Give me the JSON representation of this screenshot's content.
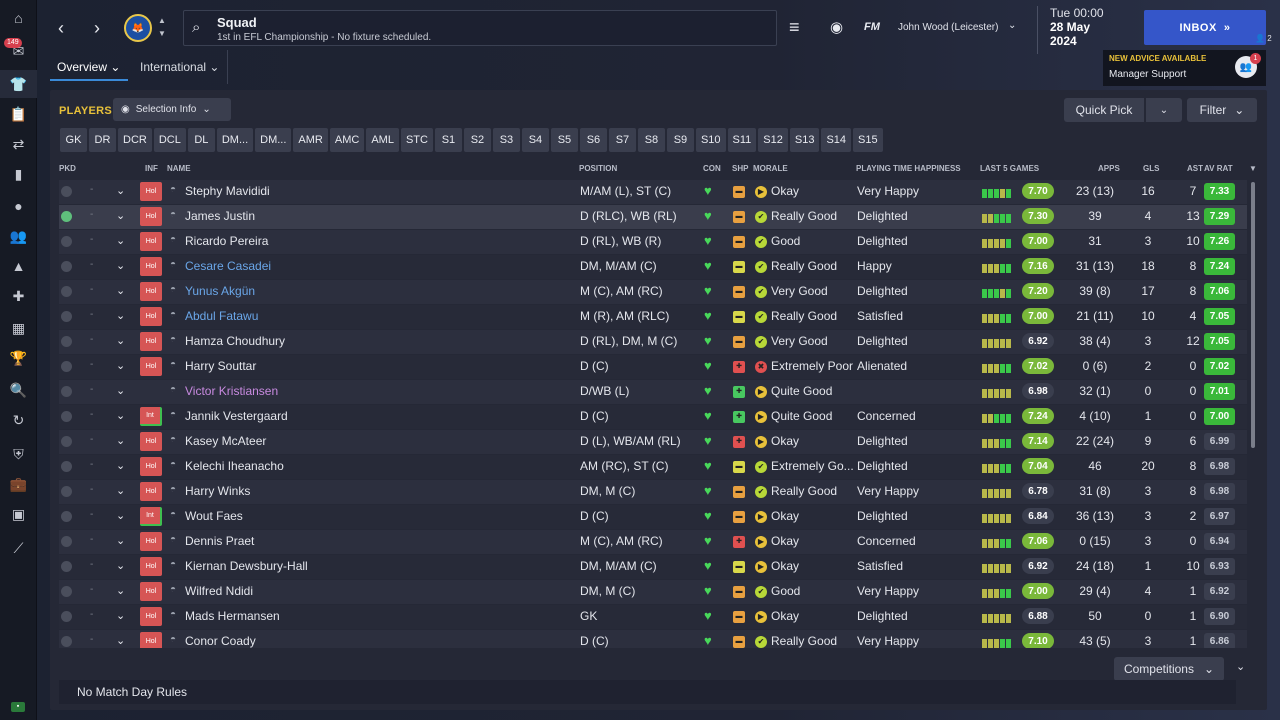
{
  "sidebar": {
    "badge": "149"
  },
  "header": {
    "title": "Squad",
    "subtitle": "1st in EFL Championship - No fixture scheduled.",
    "brand": "FM",
    "manager": "John Wood (Leicester)",
    "date_line1": "Tue 00:00",
    "date_line2": "28 May",
    "date_line3": "2024",
    "inbox_label": "INBOX",
    "inbox_count": "2",
    "advice_title": "NEW ADVICE AVAILABLE",
    "advice_sub": "Manager Support",
    "advice_badge": "1",
    "tabs": [
      "Overview",
      "International"
    ]
  },
  "toolbar": {
    "players_label": "PLAYERS",
    "selection_info": "Selection Info",
    "quick_pick": "Quick Pick",
    "filter": "Filter",
    "position_tabs": [
      "GK",
      "DR",
      "DCR",
      "DCL",
      "DL",
      "DM...",
      "DM...",
      "AMR",
      "AMC",
      "AML",
      "STC",
      "S1",
      "S2",
      "S3",
      "S4",
      "S5",
      "S6",
      "S7",
      "S8",
      "S9",
      "S10",
      "S11",
      "S12",
      "S13",
      "S14",
      "S15"
    ]
  },
  "columns": {
    "pkd": "PKD",
    "inf": "INF",
    "name": "NAME",
    "position": "POSITION",
    "con": "CON",
    "shp": "SHP",
    "morale": "MORALE",
    "pth": "PLAYING TIME HAPPINESS",
    "last5": "LAST 5 GAMES",
    "apps": "APPS",
    "gls": "GLS",
    "ast": "AST",
    "avrat": "AV RAT"
  },
  "colors": {
    "shp_good": "#d8d84a",
    "shp_ok": "#e8a040",
    "shp_bad": "#e05050",
    "shp_great": "#48c860",
    "morale_good": "#b8d838",
    "morale_ok": "#e8c13a",
    "morale_bad": "#e05050",
    "rating_high": "#3ab83a",
    "rating_mid": "#7ab83a",
    "rating_low": "#3a3e4e"
  },
  "players": [
    {
      "pkd": false,
      "inf": "Hol",
      "name": "Stephy Mavididi",
      "style": "",
      "position": "M/AM (L), ST (C)",
      "shp": "ok",
      "morale_icon": "ok",
      "morale": "Okay",
      "pth": "Very Happy",
      "last5": "gggyg",
      "avg5": "7.70",
      "apps": "23 (13)",
      "gls": "16",
      "ast": "7",
      "avrat": "7.33",
      "avrat_tier": "high"
    },
    {
      "pkd": true,
      "inf": "Hol",
      "name": "James Justin",
      "style": "",
      "position": "D (RLC), WB (RL)",
      "shp": "ok",
      "morale_icon": "good",
      "morale": "Really Good",
      "pth": "Delighted",
      "last5": "yyggg",
      "avg5": "7.30",
      "apps": "39",
      "gls": "4",
      "ast": "13",
      "avrat": "7.29",
      "avrat_tier": "high"
    },
    {
      "pkd": false,
      "inf": "Hol",
      "name": "Ricardo Pereira",
      "style": "",
      "position": "D (RL), WB (R)",
      "shp": "ok",
      "morale_icon": "good",
      "morale": "Good",
      "pth": "Delighted",
      "last5": "yyyyg",
      "avg5": "7.00",
      "apps": "31",
      "gls": "3",
      "ast": "10",
      "avrat": "7.26",
      "avrat_tier": "high"
    },
    {
      "pkd": false,
      "inf": "Hol",
      "name": "Cesare Casadei",
      "style": "loan",
      "position": "DM, M/AM (C)",
      "shp": "good",
      "morale_icon": "good",
      "morale": "Really Good",
      "pth": "Happy",
      "last5": "yyygg",
      "avg5": "7.16",
      "apps": "31 (13)",
      "gls": "18",
      "ast": "8",
      "avrat": "7.24",
      "avrat_tier": "high"
    },
    {
      "pkd": false,
      "inf": "Hol",
      "name": "Yunus Akgün",
      "style": "loan",
      "position": "M (C), AM (RC)",
      "shp": "ok",
      "morale_icon": "good",
      "morale": "Very Good",
      "pth": "Delighted",
      "last5": "gggyg",
      "avg5": "7.20",
      "apps": "39 (8)",
      "gls": "17",
      "ast": "8",
      "avrat": "7.06",
      "avrat_tier": "high"
    },
    {
      "pkd": false,
      "inf": "Hol",
      "name": "Abdul Fatawu",
      "style": "loan",
      "position": "M (R), AM (RLC)",
      "shp": "good",
      "morale_icon": "good",
      "morale": "Really Good",
      "pth": "Satisfied",
      "last5": "yyygg",
      "avg5": "7.00",
      "apps": "21 (11)",
      "gls": "10",
      "ast": "4",
      "avrat": "7.05",
      "avrat_tier": "high"
    },
    {
      "pkd": false,
      "inf": "Hol",
      "name": "Hamza Choudhury",
      "style": "",
      "position": "D (RL), DM, M (C)",
      "shp": "ok",
      "morale_icon": "good",
      "morale": "Very Good",
      "pth": "Delighted",
      "last5": "yyyyy",
      "avg5": "6.92",
      "apps": "38 (4)",
      "gls": "3",
      "ast": "12",
      "avrat": "7.05",
      "avrat_tier": "high"
    },
    {
      "pkd": false,
      "inf": "Hol",
      "name": "Harry Souttar",
      "style": "",
      "position": "D (C)",
      "shp": "bad",
      "morale_icon": "bad",
      "morale": "Extremely Poor",
      "pth": "Alienated",
      "last5": "yyygg",
      "avg5": "7.02",
      "apps": "0 (6)",
      "gls": "2",
      "ast": "0",
      "avrat": "7.02",
      "avrat_tier": "high"
    },
    {
      "pkd": false,
      "inf": "",
      "name": "Victor Kristiansen",
      "style": "trial",
      "position": "D/WB (L)",
      "shp": "great",
      "morale_icon": "ok",
      "morale": "Quite Good",
      "pth": "",
      "last5": "yyyyy",
      "avg5": "6.98",
      "apps": "32 (1)",
      "gls": "0",
      "ast": "0",
      "avrat": "7.01",
      "avrat_tier": "high"
    },
    {
      "pkd": false,
      "inf": "Int",
      "name": "Jannik Vestergaard",
      "style": "",
      "position": "D (C)",
      "shp": "great",
      "morale_icon": "ok",
      "morale": "Quite Good",
      "pth": "Concerned",
      "last5": "yyggg",
      "avg5": "7.24",
      "apps": "4 (10)",
      "gls": "1",
      "ast": "0",
      "avrat": "7.00",
      "avrat_tier": "high"
    },
    {
      "pkd": false,
      "inf": "Hol",
      "name": "Kasey McAteer",
      "style": "",
      "position": "D (L), WB/AM (RL)",
      "shp": "bad",
      "morale_icon": "ok",
      "morale": "Okay",
      "pth": "Delighted",
      "last5": "yyygg",
      "avg5": "7.14",
      "apps": "22 (24)",
      "gls": "9",
      "ast": "6",
      "avrat": "6.99",
      "avrat_tier": "low"
    },
    {
      "pkd": false,
      "inf": "Hol",
      "name": "Kelechi Iheanacho",
      "style": "",
      "position": "AM (RC), ST (C)",
      "shp": "good",
      "morale_icon": "good",
      "morale": "Extremely Go...",
      "pth": "Delighted",
      "last5": "yyygg",
      "avg5": "7.04",
      "apps": "46",
      "gls": "20",
      "ast": "8",
      "avrat": "6.98",
      "avrat_tier": "low"
    },
    {
      "pkd": false,
      "inf": "Hol",
      "name": "Harry Winks",
      "style": "",
      "position": "DM, M (C)",
      "shp": "ok",
      "morale_icon": "good",
      "morale": "Really Good",
      "pth": "Very Happy",
      "last5": "yyyyy",
      "avg5": "6.78",
      "apps": "31 (8)",
      "gls": "3",
      "ast": "8",
      "avrat": "6.98",
      "avrat_tier": "low"
    },
    {
      "pkd": false,
      "inf": "Int",
      "name": "Wout Faes",
      "style": "",
      "position": "D (C)",
      "shp": "ok",
      "morale_icon": "ok",
      "morale": "Okay",
      "pth": "Delighted",
      "last5": "yyyyy",
      "avg5": "6.84",
      "apps": "36 (13)",
      "gls": "3",
      "ast": "2",
      "avrat": "6.97",
      "avrat_tier": "low"
    },
    {
      "pkd": false,
      "inf": "Hol",
      "name": "Dennis Praet",
      "style": "",
      "position": "M (C), AM (RC)",
      "shp": "bad",
      "morale_icon": "ok",
      "morale": "Okay",
      "pth": "Concerned",
      "last5": "yyygg",
      "avg5": "7.06",
      "apps": "0 (15)",
      "gls": "3",
      "ast": "0",
      "avrat": "6.94",
      "avrat_tier": "low"
    },
    {
      "pkd": false,
      "inf": "Hol",
      "name": "Kiernan Dewsbury-Hall",
      "style": "",
      "position": "DM, M/AM (C)",
      "shp": "good",
      "morale_icon": "ok",
      "morale": "Okay",
      "pth": "Satisfied",
      "last5": "yyyyy",
      "avg5": "6.92",
      "apps": "24 (18)",
      "gls": "1",
      "ast": "10",
      "avrat": "6.93",
      "avrat_tier": "low"
    },
    {
      "pkd": false,
      "inf": "Hol",
      "name": "Wilfred Ndidi",
      "style": "",
      "position": "DM, M (C)",
      "shp": "ok",
      "morale_icon": "good",
      "morale": "Good",
      "pth": "Very Happy",
      "last5": "yyygg",
      "avg5": "7.00",
      "apps": "29 (4)",
      "gls": "4",
      "ast": "1",
      "avrat": "6.92",
      "avrat_tier": "low"
    },
    {
      "pkd": false,
      "inf": "Hol",
      "name": "Mads Hermansen",
      "style": "",
      "position": "GK",
      "shp": "ok",
      "morale_icon": "ok",
      "morale": "Okay",
      "pth": "Delighted",
      "last5": "yyyyy",
      "avg5": "6.88",
      "apps": "50",
      "gls": "0",
      "ast": "1",
      "avrat": "6.90",
      "avrat_tier": "low"
    },
    {
      "pkd": false,
      "inf": "Hol",
      "name": "Conor Coady",
      "style": "",
      "position": "D (C)",
      "shp": "ok",
      "morale_icon": "good",
      "morale": "Really Good",
      "pth": "Very Happy",
      "last5": "yyygg",
      "avg5": "7.10",
      "apps": "43 (5)",
      "gls": "3",
      "ast": "1",
      "avrat": "6.86",
      "avrat_tier": "low"
    }
  ],
  "footer": {
    "competitions": "Competitions",
    "match_day_rules": "No Match Day Rules"
  }
}
